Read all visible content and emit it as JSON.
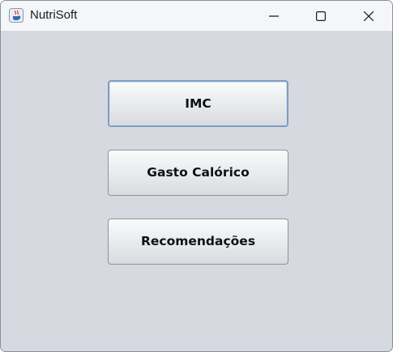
{
  "window": {
    "title": "NutriSoft",
    "controls": {
      "minimize": "minimize-icon",
      "maximize": "maximize-icon",
      "close": "close-icon"
    }
  },
  "buttons": {
    "imc": "IMC",
    "gasto": "Gasto Calórico",
    "recomendacoes": "Recomendações"
  },
  "colors": {
    "background": "#d6d9e0",
    "focus_border": "#7d9ec2"
  }
}
